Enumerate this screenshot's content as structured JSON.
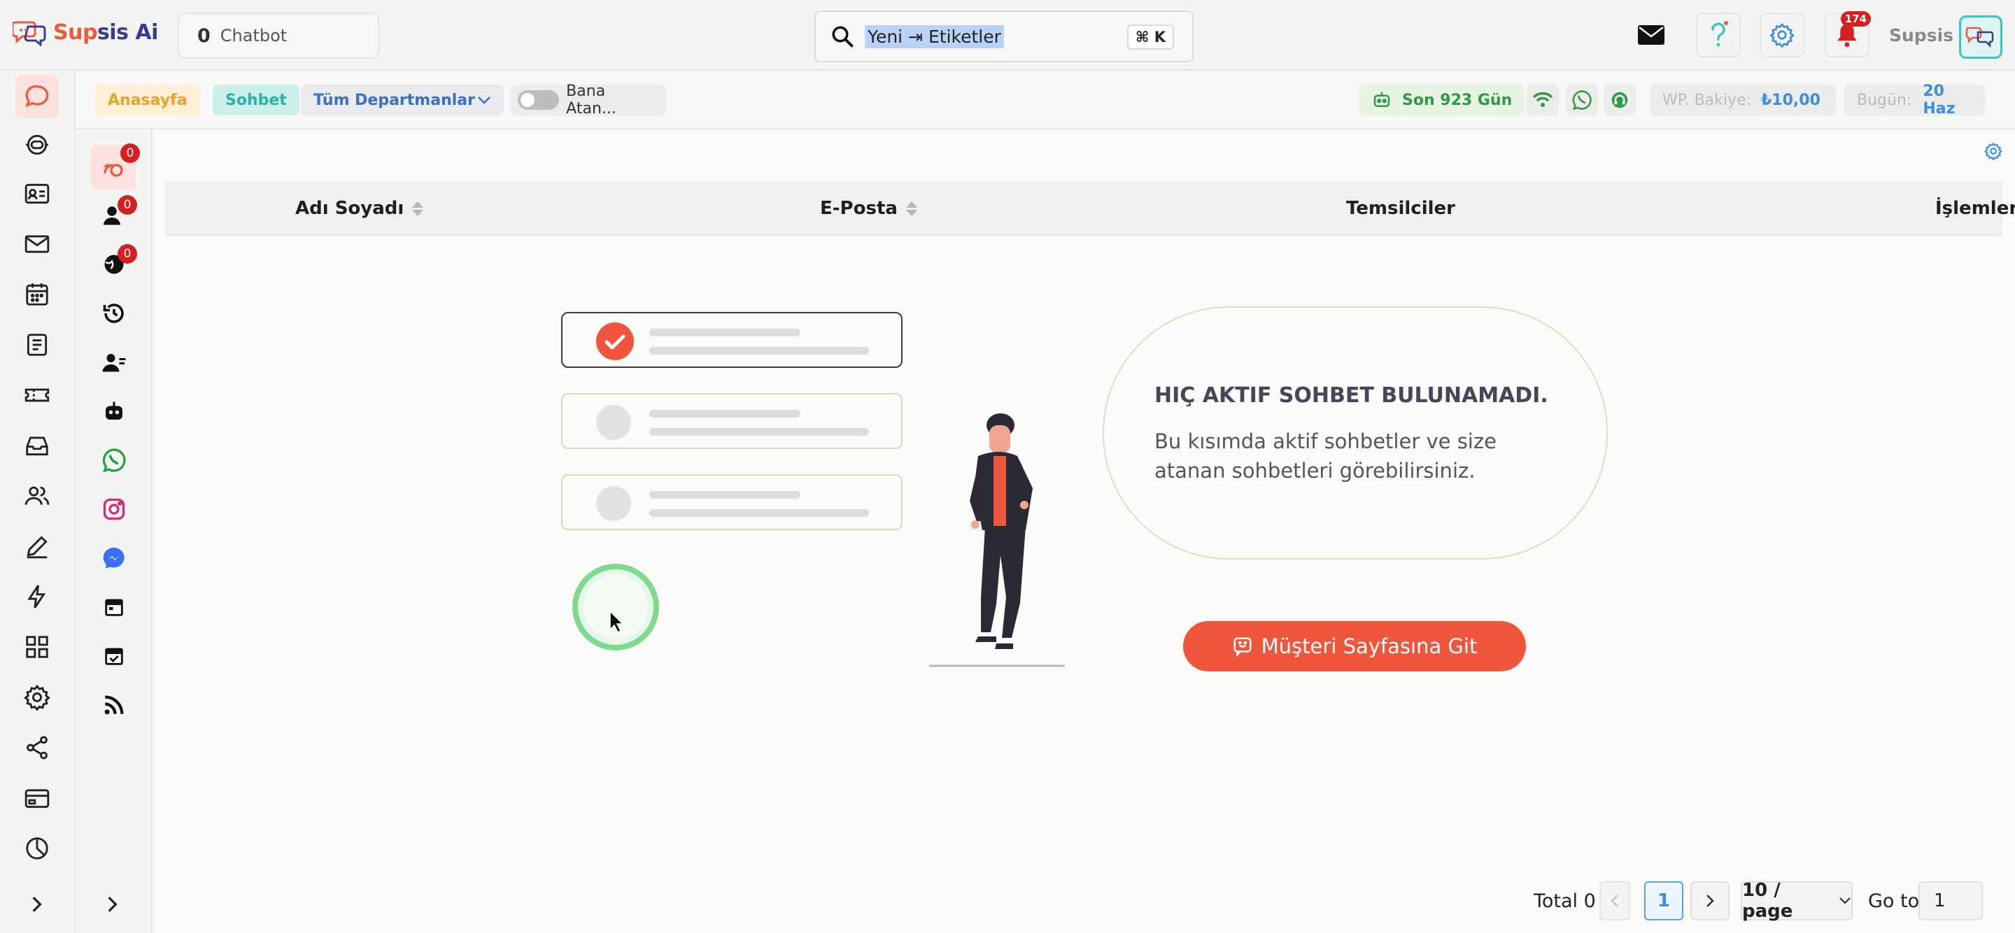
{
  "topbar": {
    "logo": {
      "brand_left": "Sup",
      "brand_right": "sis Ai"
    },
    "chatbot": {
      "count": "0",
      "label": "Chatbot"
    },
    "search": {
      "value": "Yeni ⇥ Etiketler",
      "shortcut": "⌘ K"
    },
    "notifications_count": "174",
    "user_name": "Supsis"
  },
  "filters": {
    "home": "Anasayfa",
    "chat": "Sohbet",
    "department": "Tüm Departmanlar",
    "assigned_toggle": "Bana Atan...",
    "days": "Son 923 Gün",
    "balance_label": "WP. Bakiye:",
    "balance_value": "₺10,00",
    "today_label": "Bugün:",
    "today_value": "20 Haz"
  },
  "sidebar2_badges": [
    "0",
    "0",
    "0"
  ],
  "table": {
    "columns": [
      "Adı Soyadı",
      "E-Posta",
      "Temsilciler",
      "İşlemler"
    ]
  },
  "empty_state": {
    "title": "HIÇ AKTIF SOHBET BULUNAMADI.",
    "description": "Bu kısımda aktif sohbetler ve size atanan sohbetleri görebilirsiniz.",
    "button": "Müşteri Sayfasına Git"
  },
  "pagination": {
    "total": "Total 0",
    "current_page": "1",
    "page_size": "10 / page",
    "goto_label": "Go to",
    "goto_value": "1"
  },
  "colors": {
    "accent": "#f0563c",
    "teal": "#36c9bd",
    "blue": "#3d8de0",
    "badge": "#d42020"
  }
}
